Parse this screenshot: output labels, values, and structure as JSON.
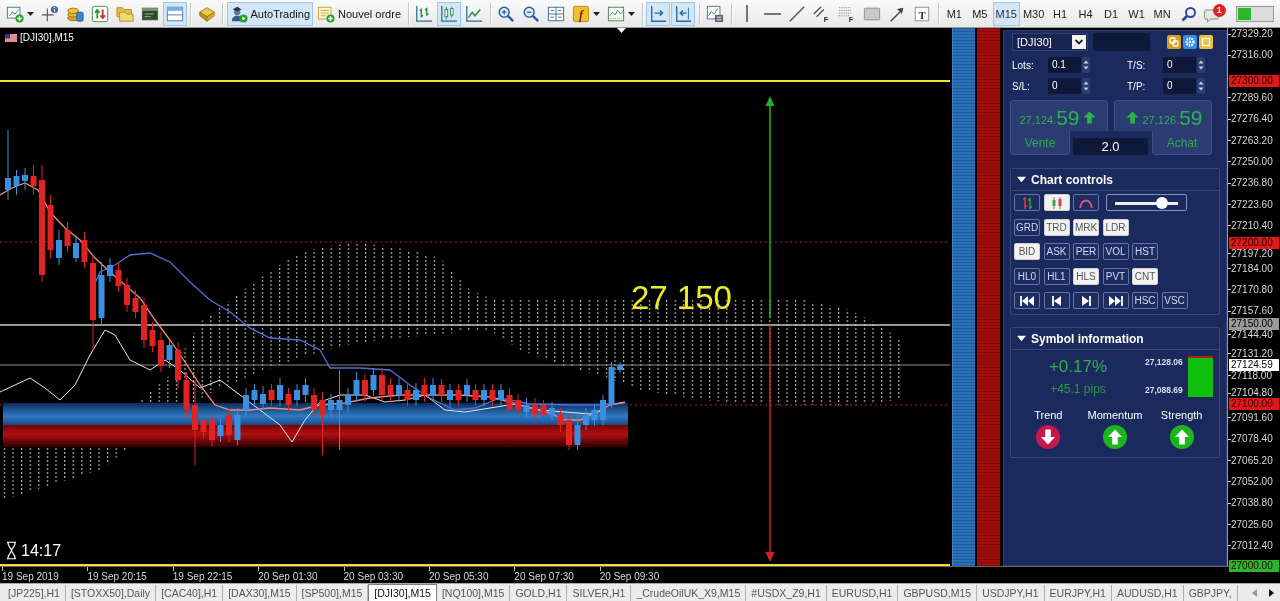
{
  "toolbar": {
    "groups": [
      [
        {
          "kind": "newchart",
          "pressed": false,
          "dropdown": true
        },
        {
          "kind": "crosshair",
          "pressed": false,
          "dropdown": false
        },
        {
          "kind": "coins",
          "pressed": false,
          "dropdown": false
        },
        {
          "kind": "transfer",
          "pressed": false,
          "dropdown": false
        },
        {
          "kind": "folders",
          "pressed": false,
          "dropdown": false
        },
        {
          "kind": "terminal",
          "pressed": false,
          "dropdown": false
        },
        {
          "kind": "layout",
          "pressed": true,
          "dropdown": false
        }
      ],
      [
        {
          "kind": "tester",
          "pressed": false,
          "dropdown": false
        }
      ],
      [
        {
          "kind": "robot",
          "label": "AutoTrading",
          "pressed": true,
          "dropdown": false
        },
        {
          "kind": "order",
          "label": "Nouvel ordre",
          "pressed": false,
          "dropdown": false
        }
      ],
      [
        {
          "kind": "bars",
          "pressed": false,
          "dropdown": false
        },
        {
          "kind": "candles",
          "pressed": true,
          "dropdown": false
        },
        {
          "kind": "line",
          "pressed": false,
          "dropdown": false
        }
      ],
      [
        {
          "kind": "zoomin",
          "pressed": false,
          "dropdown": false
        },
        {
          "kind": "zoomout",
          "pressed": false,
          "dropdown": false
        },
        {
          "kind": "tile",
          "pressed": false,
          "dropdown": false
        },
        {
          "kind": "indicators",
          "glyph": "f",
          "pressed": false,
          "dropdown": true
        },
        {
          "kind": "templates",
          "pressed": false,
          "dropdown": true
        }
      ],
      [
        {
          "kind": "autoscroll",
          "pressed": true,
          "dropdown": false
        },
        {
          "kind": "shift",
          "pressed": true,
          "dropdown": false
        }
      ],
      [
        {
          "kind": "properties",
          "pressed": false,
          "dropdown": false
        }
      ],
      [
        {
          "kind": "vline",
          "pressed": false,
          "dropdown": false
        },
        {
          "kind": "hline",
          "pressed": false,
          "dropdown": false
        },
        {
          "kind": "trend",
          "pressed": false,
          "dropdown": false
        },
        {
          "kind": "channel",
          "glyph": "F",
          "pressed": false,
          "dropdown": false
        },
        {
          "kind": "fibo",
          "glyph": "F",
          "pressed": false,
          "dropdown": false
        },
        {
          "kind": "rect",
          "pressed": false,
          "dropdown": false
        },
        {
          "kind": "arrow",
          "pressed": false,
          "dropdown": false
        },
        {
          "kind": "textlabel",
          "glyph": "T",
          "pressed": false,
          "dropdown": false
        }
      ]
    ],
    "timeframes": [
      {
        "label": "M1",
        "selected": false
      },
      {
        "label": "M5",
        "selected": false
      },
      {
        "label": "M15",
        "selected": true
      },
      {
        "label": "M30",
        "selected": false
      },
      {
        "label": "H1",
        "selected": false
      },
      {
        "label": "H4",
        "selected": false
      },
      {
        "label": "D1",
        "selected": false
      },
      {
        "label": "W1",
        "selected": false
      },
      {
        "label": "MN",
        "selected": false
      }
    ],
    "notification_badge": "1"
  },
  "chart": {
    "title": "[DJI30],M15",
    "price_label": "27 150",
    "timer": "14:17",
    "price_axis": {
      "ticks": [
        "27329.20",
        "27316.00",
        "27289.60",
        "27276.40",
        "27263.20",
        "27250.00",
        "27236.80",
        "27223.60",
        "27210.40",
        "27197.20",
        "27184.00",
        "27170.80",
        "27157.60",
        "27144.40",
        "27131.20",
        "27118.00",
        "27104.80",
        "27091.60",
        "27078.40",
        "27065.20",
        "27052.00",
        "27038.80",
        "27025.60",
        "27012.40"
      ],
      "tags": [
        {
          "label": "27300.00",
          "color": "#e01818"
        },
        {
          "label": "27200.00",
          "color": "#e01818"
        },
        {
          "label": "27150.00",
          "color": "#9a9a9a"
        },
        {
          "label": "27124.59",
          "color": "#ffffff"
        },
        {
          "label": "27100.00",
          "color": "#e01818"
        },
        {
          "label": "27000.00",
          "color": "#2db52d"
        }
      ]
    },
    "time_axis": [
      "19 Sep 2019",
      "19 Sep 20:15",
      "19 Sep 22:15",
      "20 Sep 01:30",
      "20 Sep 03:30",
      "20 Sep 05:30",
      "20 Sep 07:30",
      "20 Sep 09:30"
    ]
  },
  "trade_panel": {
    "symbol": "[DJI30]",
    "fields": [
      {
        "label": "Lots:",
        "value": "0.1"
      },
      {
        "label": "T/S:",
        "value": "0"
      },
      {
        "label": "S/L:",
        "value": "0"
      },
      {
        "label": "T/P:",
        "value": "0"
      }
    ],
    "sell": {
      "price_main": "27,124.",
      "price_pips": "59",
      "label": "Vente",
      "rising": true
    },
    "buy": {
      "price_main": "27,126.",
      "price_pips": "59",
      "label": "Achat",
      "rising": true
    },
    "volume": "2.0"
  },
  "chart_controls": {
    "title": "Chart controls",
    "expanded": true,
    "rows": [
      {
        "buttons": [
          {
            "kind": "bars",
            "on": false
          },
          {
            "kind": "candles",
            "on": true
          },
          {
            "kind": "line",
            "on": false
          }
        ],
        "slider": {
          "level": 0.75
        }
      },
      {
        "buttons": [
          {
            "kind": "text",
            "label": "GRD",
            "on": false
          },
          {
            "kind": "text",
            "label": "TRD",
            "on": true
          },
          {
            "kind": "text",
            "label": "MRK",
            "on": true
          },
          {
            "kind": "text",
            "label": "LDR",
            "on": true
          }
        ]
      },
      {
        "buttons": [
          {
            "kind": "text",
            "label": "BID",
            "on": true
          },
          {
            "kind": "text",
            "label": "ASK",
            "on": false
          },
          {
            "kind": "text",
            "label": "PER",
            "on": false
          },
          {
            "kind": "text",
            "label": "VOL",
            "on": false
          },
          {
            "kind": "text",
            "label": "HST",
            "on": false
          }
        ]
      },
      {
        "buttons": [
          {
            "kind": "text",
            "label": "HL0",
            "on": false
          },
          {
            "kind": "text",
            "label": "HL1",
            "on": false
          },
          {
            "kind": "text",
            "label": "HLS",
            "on": true
          },
          {
            "kind": "text",
            "label": "PVT",
            "on": false
          },
          {
            "kind": "text",
            "label": "CNT",
            "on": true
          }
        ]
      },
      {
        "buttons": [
          {
            "kind": "first",
            "on": false
          },
          {
            "kind": "prev",
            "on": false
          },
          {
            "kind": "next",
            "on": false
          },
          {
            "kind": "last",
            "on": false
          },
          {
            "kind": "text",
            "label": "HSC",
            "on": false
          },
          {
            "kind": "text",
            "label": "VSC",
            "on": false
          }
        ]
      }
    ]
  },
  "symbol_information": {
    "title": "Symbol information",
    "expanded": true,
    "change": "+0.17%",
    "pips": "+45.1 pips",
    "high": "27,128.06",
    "low": "27,088.69",
    "signals": [
      {
        "label": "Trend",
        "rising": false
      },
      {
        "label": "Momentum",
        "rising": true
      },
      {
        "label": "Strength",
        "rising": true
      }
    ]
  },
  "tabs": [
    {
      "label": "[JP225],H1",
      "selected": false
    },
    {
      "label": "[STOXX50],Daily",
      "selected": false
    },
    {
      "label": "[CAC40],H1",
      "selected": false
    },
    {
      "label": "[DAX30],M15",
      "selected": false
    },
    {
      "label": "[SP500],M15",
      "selected": false
    },
    {
      "label": "[DJI30],M15",
      "selected": true
    },
    {
      "label": "[NQ100],M15",
      "selected": false
    },
    {
      "label": "GOLD,H1",
      "selected": false
    },
    {
      "label": "SILVER,H1",
      "selected": false
    },
    {
      "label": "_CrudeOilUK_X9,M15",
      "selected": false
    },
    {
      "label": "#USDX_Z9,H1",
      "selected": false
    },
    {
      "label": "EURUSD,H1",
      "selected": false
    },
    {
      "label": "GBPUSD,M15",
      "selected": false
    },
    {
      "label": "USDJPY,H1",
      "selected": false
    },
    {
      "label": "EURJPY,H1",
      "selected": false
    },
    {
      "label": "AUDUSD,H1",
      "selected": false
    },
    {
      "label": "GBPJPY,",
      "selected": false
    }
  ]
}
